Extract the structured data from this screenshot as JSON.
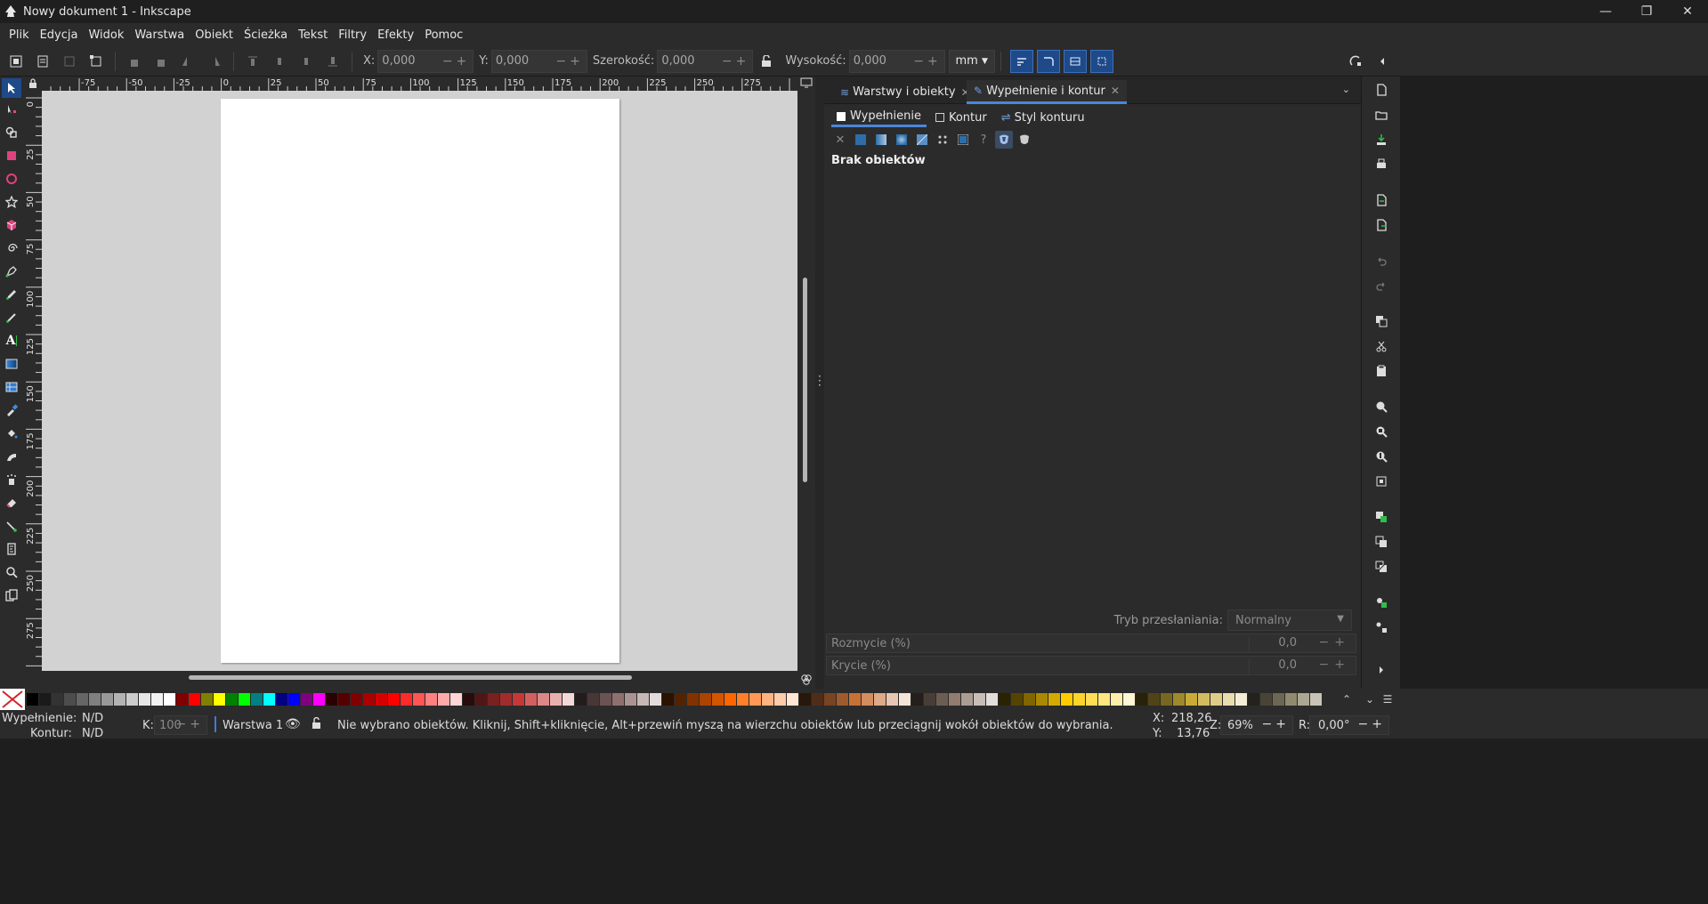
{
  "window": {
    "title": "Nowy dokument 1 - Inkscape",
    "controls": [
      "minimize-icon",
      "restore-icon",
      "close-icon"
    ]
  },
  "menu": [
    "Plik",
    "Edycja",
    "Widok",
    "Warstwa",
    "Obiekt",
    "Ścieżka",
    "Tekst",
    "Filtry",
    "Efekty",
    "Pomoc"
  ],
  "toolbar": {
    "x_label": "X:",
    "x_value": "0,000",
    "y_label": "Y:",
    "y_value": "0,000",
    "w_label": "Szerokość:",
    "w_value": "0,000",
    "h_label": "Wysokość:",
    "h_value": "0,000",
    "unit": "mm"
  },
  "rulers": {
    "h_ticks": [
      "-75",
      "-50",
      "-25",
      "0",
      "25",
      "50",
      "75",
      "100",
      "125",
      "150",
      "175",
      "200",
      "225",
      "250",
      "275"
    ],
    "v_ticks": [
      "0",
      "25",
      "50",
      "75",
      "100",
      "125",
      "150",
      "175",
      "200",
      "225",
      "250",
      "275"
    ]
  },
  "dock": {
    "tabs": [
      {
        "label": "Warstwy i obiekty"
      },
      {
        "label": "Wypełnienie i kontur"
      }
    ],
    "subtabs": [
      "Wypełnienie",
      "Kontur",
      "Styl konturu"
    ],
    "no_objects": "Brak obiektów",
    "blend_label": "Tryb przesłaniania:",
    "blend_value": "Normalny",
    "blur_label": "Rozmycie (%)",
    "blur_value": "0,0",
    "opacity_label": "Krycie (%)",
    "opacity_value": "0,0"
  },
  "palette": {
    "colors": [
      "#000000",
      "#1a1a1a",
      "#333333",
      "#4d4d4d",
      "#666666",
      "#808080",
      "#999999",
      "#b3b3b3",
      "#cccccc",
      "#e6e6e6",
      "#f2f2f2",
      "#ffffff",
      "#800000",
      "#ff0000",
      "#808000",
      "#ffff00",
      "#008000",
      "#00ff00",
      "#008080",
      "#00ffff",
      "#000080",
      "#0000ff",
      "#800080",
      "#ff00ff",
      "#2b0000",
      "#550000",
      "#800000",
      "#aa0000",
      "#d40000",
      "#ff0000",
      "#ff2a2a",
      "#ff5555",
      "#ff8080",
      "#ffaaaa",
      "#ffd5d5",
      "#280b0b",
      "#501616",
      "#782121",
      "#a02c2c",
      "#c83737",
      "#d35f5f",
      "#de8787",
      "#e9afaf",
      "#f4d7d7",
      "#241c1c",
      "#483737",
      "#6c5353",
      "#916f6f",
      "#ac9393",
      "#c8b7b7",
      "#e3dbdb",
      "#2b1100",
      "#552200",
      "#803300",
      "#aa4400",
      "#d45500",
      "#ff6600",
      "#ff7f2a",
      "#ff9955",
      "#ffb380",
      "#ffccaa",
      "#ffe6d5",
      "#28170b",
      "#502d16",
      "#784421",
      "#a05a2c",
      "#c87137",
      "#d38d5f",
      "#deaa87",
      "#e9c6af",
      "#f4e3d7",
      "#241f1c",
      "#483e37",
      "#6c5d53",
      "#917c6f",
      "#ac9d93",
      "#c8beb7",
      "#e3dedb",
      "#2b2200",
      "#554400",
      "#806600",
      "#aa8800",
      "#d4aa00",
      "#ffcc00",
      "#ffd42a",
      "#ffdd55",
      "#ffe680",
      "#ffeeaa",
      "#fff6d5",
      "#28220b",
      "#504416",
      "#786721",
      "#a0892c",
      "#c8ab37",
      "#d3bc5f",
      "#decd87",
      "#e9ddaf",
      "#f4eed7",
      "#24221c",
      "#484537",
      "#6c6753",
      "#918a6f",
      "#aca793",
      "#c8c4b7"
    ]
  },
  "status": {
    "fill_label": "Wypełnienie:",
    "fill_value": "N/D",
    "stroke_label": "Kontur:",
    "stroke_value": "N/D",
    "k_label": "K:",
    "k_value": "100",
    "layer": "Warstwa 1",
    "message": "Nie wybrano obiektów. Kliknij, Shift+kliknięcie, Alt+przewiń myszą na wierzchu obiektów lub przeciągnij wokół obiektów do wybrania.",
    "x_label": "X:",
    "x_value": "218,26",
    "y_label": "Y:",
    "y_value": "13,76",
    "z_label": "Z:",
    "z_value": "69%",
    "r_label": "R:",
    "r_value": "0,00°"
  }
}
